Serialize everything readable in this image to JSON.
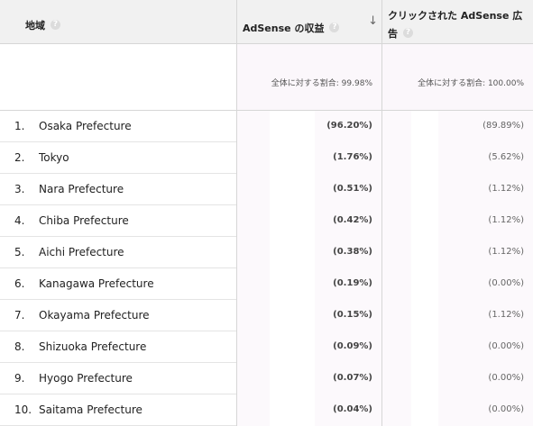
{
  "header": {
    "col1": "地域",
    "col2": "AdSense の収益",
    "col3_line1": "クリックされた AdSense 広",
    "col3_line2": "告",
    "help_glyph": "?",
    "sort_glyph": "↓"
  },
  "summary": {
    "col2": "全体に対する割合: 99.98%",
    "col3": "全体に対する割合: 100.00%"
  },
  "rows": [
    {
      "num": "1.",
      "name": "Osaka Prefecture",
      "revenue": "(96.20%)",
      "clicks": "(89.89%)"
    },
    {
      "num": "2.",
      "name": "Tokyo",
      "revenue": "(1.76%)",
      "clicks": "(5.62%)"
    },
    {
      "num": "3.",
      "name": "Nara Prefecture",
      "revenue": "(0.51%)",
      "clicks": "(1.12%)"
    },
    {
      "num": "4.",
      "name": "Chiba Prefecture",
      "revenue": "(0.42%)",
      "clicks": "(1.12%)"
    },
    {
      "num": "5.",
      "name": "Aichi Prefecture",
      "revenue": "(0.38%)",
      "clicks": "(1.12%)"
    },
    {
      "num": "6.",
      "name": "Kanagawa Prefecture",
      "revenue": "(0.19%)",
      "clicks": "(0.00%)"
    },
    {
      "num": "7.",
      "name": "Okayama Prefecture",
      "revenue": "(0.15%)",
      "clicks": "(1.12%)"
    },
    {
      "num": "8.",
      "name": "Shizuoka Prefecture",
      "revenue": "(0.09%)",
      "clicks": "(0.00%)"
    },
    {
      "num": "9.",
      "name": "Hyogo Prefecture",
      "revenue": "(0.07%)",
      "clicks": "(0.00%)"
    },
    {
      "num": "10.",
      "name": "Saitama Prefecture",
      "revenue": "(0.04%)",
      "clicks": "(0.00%)"
    }
  ]
}
